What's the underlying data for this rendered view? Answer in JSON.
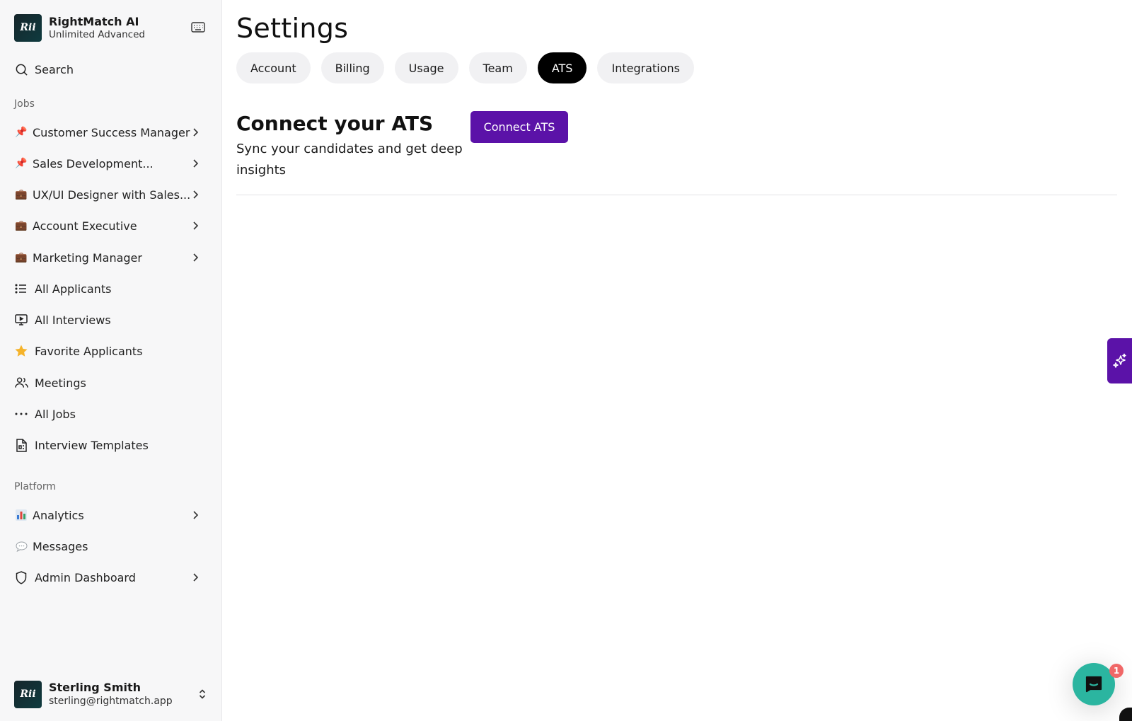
{
  "brand": {
    "name": "RightMatch AI",
    "plan": "Unlimited Advanced",
    "logo_text": "Rii"
  },
  "search": {
    "label": "Search"
  },
  "sections": {
    "jobs": "Jobs",
    "platform": "Platform"
  },
  "jobs": [
    {
      "label": "Customer Success Manager",
      "emoji": "📌"
    },
    {
      "label": "Sales Development...",
      "emoji": "📌"
    },
    {
      "label": "UX/UI Designer with Sales...",
      "emoji": "💼"
    },
    {
      "label": "Account Executive",
      "emoji": "💼"
    },
    {
      "label": "Marketing Manager",
      "emoji": "💼"
    }
  ],
  "nav": {
    "all_applicants": "All Applicants",
    "all_interviews": "All Interviews",
    "favorite_applicants": "Favorite Applicants",
    "meetings": "Meetings",
    "all_jobs": "All Jobs",
    "interview_templates": "Interview Templates"
  },
  "platform": {
    "analytics": "Analytics",
    "messages": "Messages",
    "admin_dashboard": "Admin Dashboard"
  },
  "user": {
    "name": "Sterling Smith",
    "email": "sterling@rightmatch.app"
  },
  "page": {
    "title": "Settings"
  },
  "tabs": [
    {
      "label": "Account",
      "active": false
    },
    {
      "label": "Billing",
      "active": false
    },
    {
      "label": "Usage",
      "active": false
    },
    {
      "label": "Team",
      "active": false
    },
    {
      "label": "ATS",
      "active": true
    },
    {
      "label": "Integrations",
      "active": false
    }
  ],
  "ats": {
    "heading": "Connect your ATS",
    "subtitle": "Sync your candidates and get deep insights",
    "button": "Connect ATS"
  },
  "chat": {
    "badge": "1"
  },
  "colors": {
    "accent": "#5b12a8",
    "chat": "#2bb5a0",
    "badge": "#f06767"
  }
}
